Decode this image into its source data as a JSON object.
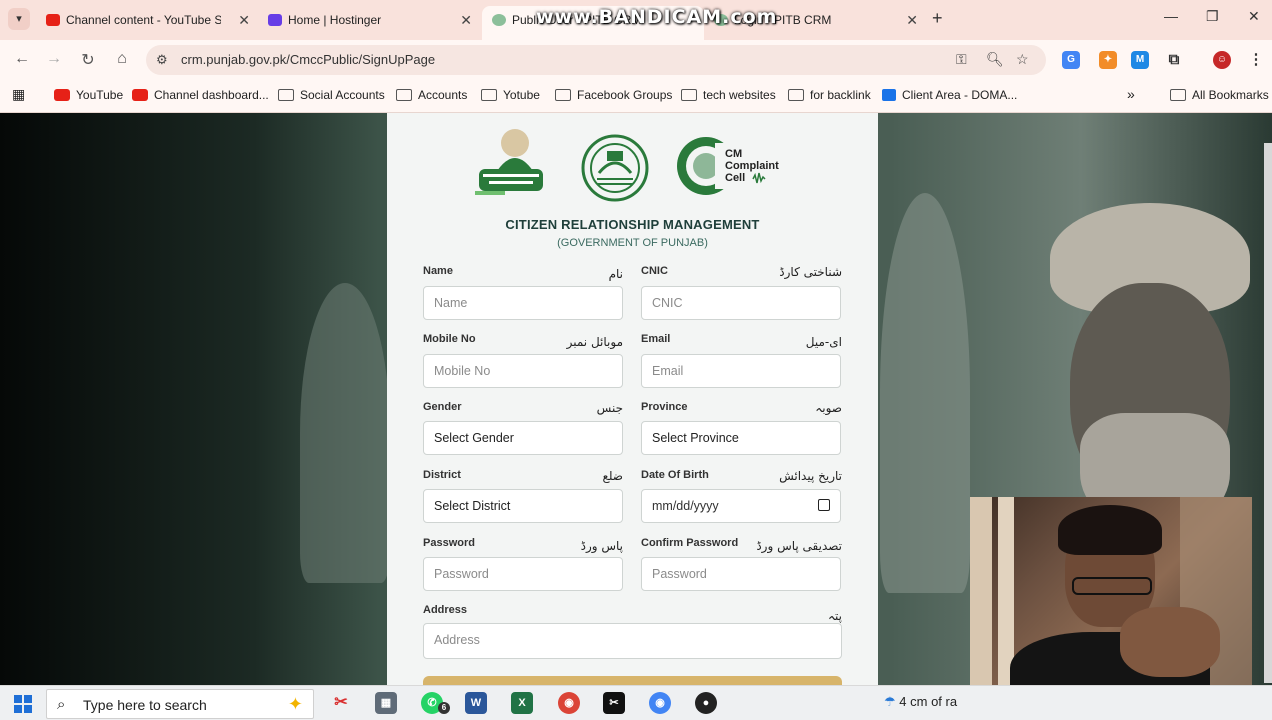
{
  "browser": {
    "tabs": [
      {
        "title": "Channel content - YouTube Studio",
        "fav_color": "#e62117"
      },
      {
        "title": "Home | Hostinger",
        "fav_color": "#673de6"
      },
      {
        "title": "Public User - PITB CRM",
        "fav_color": "#8cbf9a"
      },
      {
        "title": "Login - PITB CRM",
        "fav_color": "#8cbf9a"
      }
    ],
    "url": "crm.punjab.gov.pk/CmccPublic/SignUpPage",
    "bookmarks": [
      {
        "label": "YouTube",
        "icon": "youtube-icon"
      },
      {
        "label": "Channel dashboard...",
        "icon": "youtube-icon"
      },
      {
        "label": "Social Accounts",
        "icon": "folder-icon"
      },
      {
        "label": "Accounts",
        "icon": "folder-icon"
      },
      {
        "label": "Yotube",
        "icon": "folder-icon"
      },
      {
        "label": "Facebook Groups",
        "icon": "folder-icon"
      },
      {
        "label": "tech websites",
        "icon": "folder-icon"
      },
      {
        "label": "for backlink",
        "icon": "folder-icon"
      },
      {
        "label": "Client Area - DOMA...",
        "icon": "domain-icon"
      }
    ],
    "all_bookmarks": "All Bookmarks",
    "more_bookmarks": "»"
  },
  "watermark": "www.BANDICAM.com",
  "form": {
    "logo3_text": [
      "CM",
      "Complaint",
      "Cell"
    ],
    "title": "CITIZEN RELATIONSHIP MANAGEMENT",
    "subtitle": "(GOVERNMENT OF PUNJAB)",
    "name": {
      "label": "Name",
      "urdu": "نام",
      "placeholder": "Name"
    },
    "cnic": {
      "label": "CNIC",
      "urdu": "شناختی کارڈ",
      "placeholder": "CNIC"
    },
    "mobile": {
      "label": "Mobile No",
      "urdu": "موبائل نمبر",
      "placeholder": "Mobile No"
    },
    "email": {
      "label": "Email",
      "urdu": "ای-میل",
      "placeholder": "Email"
    },
    "gender": {
      "label": "Gender",
      "urdu": "جنس",
      "value": "Select Gender"
    },
    "province": {
      "label": "Province",
      "urdu": "صوبہ",
      "value": "Select Province"
    },
    "district": {
      "label": "District",
      "urdu": "ضلع",
      "value": "Select District"
    },
    "dob": {
      "label": "Date Of Birth",
      "urdu": "تاریخ پیدائش",
      "value": "mm/dd/yyyy"
    },
    "password": {
      "label": "Password",
      "urdu": "پاس ورڈ",
      "placeholder": "Password"
    },
    "confirm_password": {
      "label": "Confirm Password",
      "urdu": "تصدیقی پاس ورڈ",
      "placeholder": "Password"
    },
    "address": {
      "label": "Address",
      "urdu": "پتہ",
      "placeholder": "Address"
    }
  },
  "taskbar": {
    "search_placeholder": "Type here to search",
    "whatsapp_badge": "6",
    "weather": "4 cm of ra"
  },
  "colors": {
    "accent_green": "#2a7a3b",
    "title_color": "#1f3f3a",
    "submit_gold": "#d7b46a"
  }
}
